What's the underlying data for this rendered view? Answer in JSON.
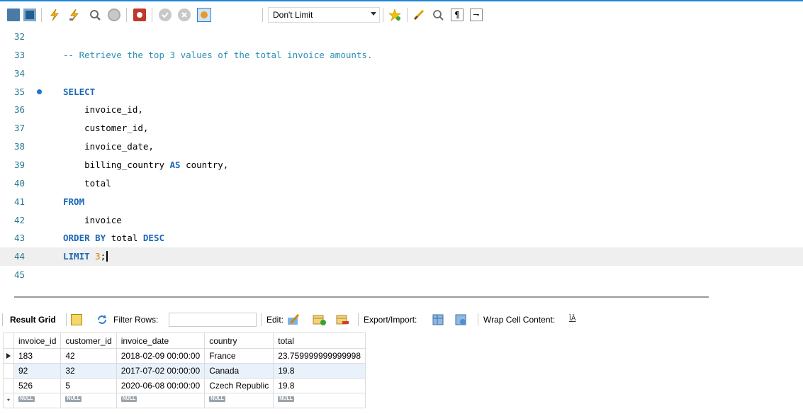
{
  "toolbar": {
    "limit_select": "Don't Limit",
    "icons": [
      "open-folder-icon",
      "save-icon",
      "execute-icon",
      "execute-current-icon",
      "explain-icon",
      "stop-icon",
      "toggle-error-icon",
      "commit-icon",
      "rollback-icon",
      "autocommit-icon",
      "beautify-bookmark-icon",
      "beautify-icon",
      "find-icon",
      "invisible-chars-icon",
      "wrap-icon"
    ]
  },
  "editor": {
    "lines": [
      {
        "n": "32",
        "html": ""
      },
      {
        "n": "33",
        "html": "<span class='cm'>-- Retrieve the top 3 values of the total invoice amounts.</span>"
      },
      {
        "n": "34",
        "html": ""
      },
      {
        "n": "35",
        "html": "<span class='kw'>SELECT</span>",
        "breakpoint": true
      },
      {
        "n": "36",
        "html": "    invoice_id,"
      },
      {
        "n": "37",
        "html": "    customer_id,"
      },
      {
        "n": "38",
        "html": "    invoice_date,"
      },
      {
        "n": "39",
        "html": "    billing_country <span class='kw'>AS</span> country,"
      },
      {
        "n": "40",
        "html": "    total"
      },
      {
        "n": "41",
        "html": "<span class='kw'>FROM</span>"
      },
      {
        "n": "42",
        "html": "    invoice"
      },
      {
        "n": "43",
        "html": "<span class='kw'>ORDER BY</span> total <span class='kw'>DESC</span>"
      },
      {
        "n": "44",
        "html": "<span class='kw'>LIMIT</span> <span class='num'>3</span>;<span class='cursor'></span>",
        "current": true
      },
      {
        "n": "45",
        "html": ""
      }
    ]
  },
  "result_toolbar": {
    "result_grid": "Result Grid",
    "filter_rows": "Filter Rows:",
    "filter_value": "",
    "edit": "Edit:",
    "export_import": "Export/Import:",
    "wrap_cell": "Wrap Cell Content:"
  },
  "grid": {
    "columns": [
      "invoice_id",
      "customer_id",
      "invoice_date",
      "country",
      "total"
    ],
    "rows": [
      [
        "183",
        "42",
        "2018-02-09 00:00:00",
        "France",
        "23.759999999999998"
      ],
      [
        "92",
        "32",
        "2017-07-02 00:00:00",
        "Canada",
        "19.8"
      ],
      [
        "526",
        "5",
        "2020-06-08 00:00:00",
        "Czech Republic",
        "19.8"
      ]
    ],
    "null_label": "NULL"
  }
}
